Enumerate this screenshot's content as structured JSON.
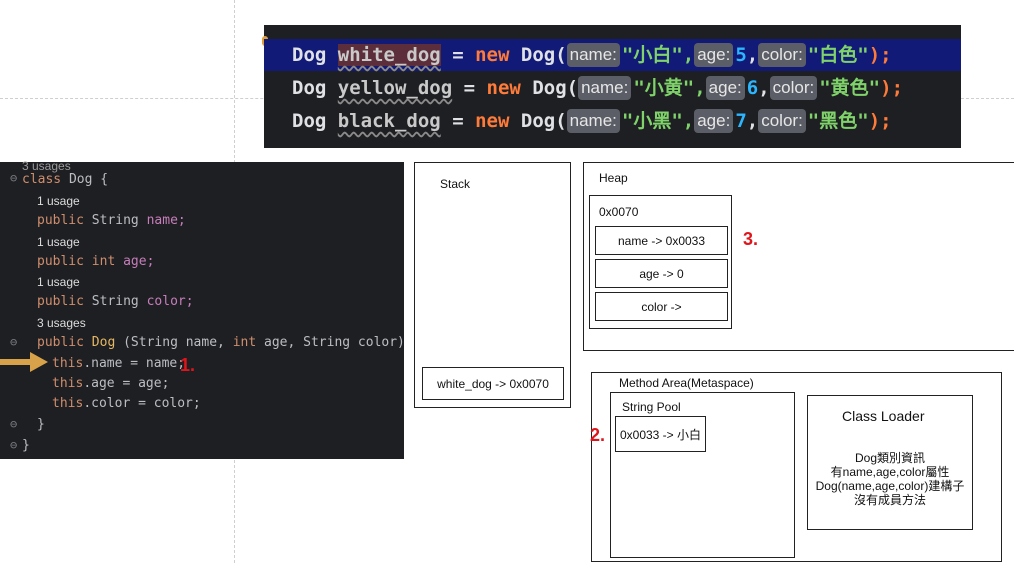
{
  "snippet": {
    "rows": [
      {
        "type": "Dog",
        "var": "white_dog",
        "eq": "=",
        "new": "new",
        "ctor": "Dog(",
        "hint_name": "name:",
        "name_val": "\"小白\",",
        "hint_age": "age:",
        "age_val": "5",
        "hint_color": "color:",
        "color_val": "\"白色\"",
        "end": ");"
      },
      {
        "type": "Dog",
        "var": "yellow_dog",
        "eq": "=",
        "new": "new",
        "ctor": "Dog(",
        "hint_name": "name:",
        "name_val": "\"小黄\",",
        "hint_age": "age:",
        "age_val": "6",
        "hint_color": "color:",
        "color_val": "\"黄色\"",
        "end": ");"
      },
      {
        "type": "Dog",
        "var": "black_dog",
        "eq": "=",
        "new": "new",
        "ctor": "Dog(",
        "hint_name": "name:",
        "name_val": "\"小黑\",",
        "hint_age": "age:",
        "age_val": "7",
        "hint_color": "color:",
        "color_val": "\"黑色\"",
        "end": ");"
      }
    ]
  },
  "class_code": {
    "top_usage": "3 usages",
    "class_kw": "class",
    "class_name": "Dog {",
    "usage1": "1 usage",
    "f1_pub": "public",
    "f1_type": "String",
    "f1_name": "name;",
    "usage2": "1 usage",
    "f2_pub": "public",
    "f2_type": "int",
    "f2_name": "age;",
    "usage3": "1 usage",
    "f3_pub": "public",
    "f3_type": "String",
    "f3_name": "color;",
    "usage4": "3 usages",
    "ctor_pub": "public",
    "ctor_name": "Dog",
    "ctor_params_a": "(String name,",
    "ctor_params_int": "int",
    "ctor_params_b": "age, String color) {",
    "l1_this": "this",
    "l1_rest": ".name = name;",
    "l2_this": "this",
    "l2_rest": ".age = age;",
    "l3_this": "this",
    "l3_rest": ".color = color;",
    "close1": "}",
    "close2": "}"
  },
  "markers": {
    "m1": "1.",
    "m2": "2.",
    "m3": "3."
  },
  "stack": {
    "title": "Stack",
    "entry": "white_dog -> 0x0070"
  },
  "heap": {
    "title": "Heap",
    "object_addr": "0x0070",
    "fields": [
      "name -> 0x0033",
      "age -> 0",
      "color ->"
    ]
  },
  "method_area": {
    "title": "Method Area(Metaspace)",
    "string_pool_title": "String Pool",
    "string_pool_entry": "0x0033 -> 小白",
    "class_loader_title": "Class Loader",
    "class_loader_lines": [
      "Dog類別資訊",
      "有name,age,color屬性",
      "Dog(name,age,color)建構子",
      "沒有成員方法"
    ]
  },
  "colors": {
    "accent_red": "#e0151b",
    "arrow": "#d8a24a",
    "editor_bg": "#1e1f22",
    "selected_line": "#111a77"
  }
}
